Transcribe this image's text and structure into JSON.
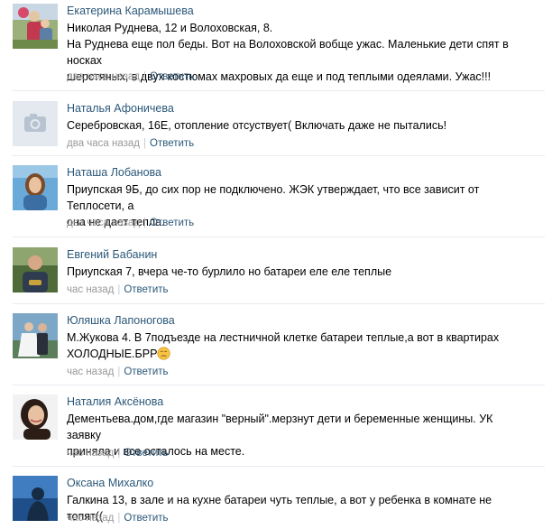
{
  "comments": [
    {
      "author": "Екатерина Карамышева",
      "lines": [
        "Николая Руднева, 12 и Волоховская, 8.",
        "На Руднева еще пол беды. Вот на Волоховской вобще ужас. Маленькие дети спят в носках",
        "шерстяных, в двух костюмах махровых да еще и под теплыми одеялами. Ужас!!!"
      ],
      "time": "два часа назад",
      "reply": "Ответить",
      "avatar": "photo-woman-with-child"
    },
    {
      "author": "Наталья Афоничева",
      "lines": [
        "Серебровская, 16Е, отопление отсуствует( Включать даже не пытались!"
      ],
      "time": "два часа назад",
      "reply": "Ответить",
      "avatar": "camera-placeholder-icon"
    },
    {
      "author": "Наташа Лобанова",
      "lines": [
        "Приупская 9Б, до сих пор не подключено. ЖЭК утверждает, что все зависит от Теплосети, а",
        "она не дает тепла."
      ],
      "time": "два часа назад",
      "reply": "Ответить",
      "avatar": "photo-woman-blue-background"
    },
    {
      "author": "Евгений Бабанин",
      "lines": [
        "Приупская 7, вчера че-то бурлило но батареи еле еле теплые"
      ],
      "time": "час назад",
      "reply": "Ответить",
      "avatar": "photo-man-outdoors"
    },
    {
      "author": "Юляшка Лапоногова",
      "lines": [
        "М.Жукова 4. В 7подъезде на лестничной клетке батареи теплые,а вот в квартирах",
        "ХОЛОДНЫЕ.БРР"
      ],
      "time": "час назад",
      "reply": "Ответить",
      "avatar": "photo-wedding-couple"
    },
    {
      "author": "Наталия Аксёнова",
      "lines": [
        "Дементьева.дом,где магазин \"верный\".мерзнут дети и беременные женщины. УК заявку",
        "приняла и все осталось на месте."
      ],
      "time": "час назад",
      "reply": "Ответить",
      "avatar": "photo-smiling-woman"
    },
    {
      "author": "Оксана Михалко",
      "lines": [
        "Галкина 13, в зале и на кухне батареи чуть теплые, а вот у ребенка в комнате не топят(("
      ],
      "time": "час назад",
      "reply": "Ответить",
      "avatar": "photo-silhouette-blue"
    }
  ],
  "colors": {
    "link": "#2b587a",
    "meta": "#999999",
    "divider": "#e7ebf0"
  }
}
